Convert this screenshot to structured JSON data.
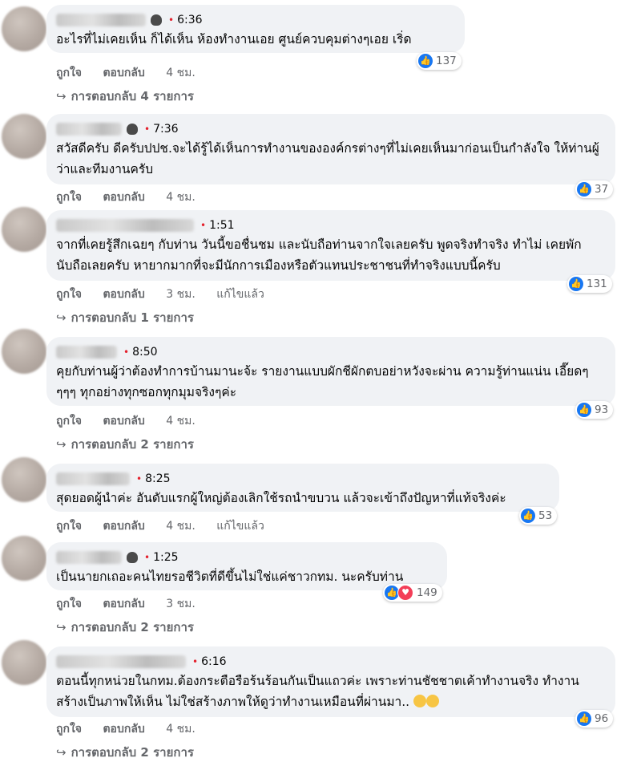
{
  "comments": [
    {
      "time": "6:36",
      "text": "อะไรที่ไม่เคยเห็น ก็ได้เห็น ห้องทำงานเอย ศูนย์ควบคุมต่างๆเอย เริ่ด",
      "like": "ถูกใจ",
      "reply": "ตอบกลับ",
      "age": "4 ชม.",
      "edited": "",
      "reactions": "137",
      "replies": "การตอบกลับ 4 รายการ"
    },
    {
      "time": "7:36",
      "text": "สวัสดีครับ ดีครับปปช.จะได้รู้ได้เห็นการทำงานขององค์กรต่างๆที่ไม่เคยเห็นมาก่อนเป็นกำลังใจ ให้ท่านผู้ว่าและทีมงานครับ",
      "like": "ถูกใจ",
      "reply": "ตอบกลับ",
      "age": "4 ชม.",
      "edited": "",
      "reactions": "37",
      "replies": ""
    },
    {
      "time": "1:51",
      "text": "จากที่เคยรู้สึกเฉยๆ กับท่าน วันนี้ขอชื่นชม และนับถือท่านจากใจเลยครับ พูดจริงทำจริง ทำไม่ เคยพัก นับถือเลยครับ หายากมากที่จะมีนักการเมืองหรือตัวแทนประชาชนที่ทำจริงแบบนี้ครับ",
      "like": "ถูกใจ",
      "reply": "ตอบกลับ",
      "age": "3 ชม.",
      "edited": "แก้ไขแล้ว",
      "reactions": "131",
      "replies": "การตอบกลับ 1 รายการ"
    },
    {
      "time": "8:50",
      "text": "คุยกับท่านผู้ว่าต้องทำการบ้านมานะจ้ะ รายงานแบบผักชีผักตบอย่าหวังจะผ่าน ความรู้ท่านแน่น เอี๊ยดๆๆๆๆ ทุกอย่างทุกซอกทุกมุมจริงๆค่ะ",
      "like": "ถูกใจ",
      "reply": "ตอบกลับ",
      "age": "4 ชม.",
      "edited": "",
      "reactions": "93",
      "replies": "การตอบกลับ 2 รายการ"
    },
    {
      "time": "8:25",
      "text": "สุดยอดผู้นำค่ะ อันดับแรกผู้ใหญ่ต้องเลิกใช้รถนำขบวน แล้วจะเข้าถึงปัญหาที่แท้จริงค่ะ",
      "like": "ถูกใจ",
      "reply": "ตอบกลับ",
      "age": "4 ชม.",
      "edited": "แก้ไขแล้ว",
      "reactions": "53",
      "replies": ""
    },
    {
      "time": "1:25",
      "text": "เป็นนายกเถอะคนไทยรอชีวิตที่ดีขึ้นไม่ใช่แค่ชาวกทม. นะครับท่าน",
      "like": "ถูกใจ",
      "reply": "ตอบกลับ",
      "age": "3 ชม.",
      "edited": "",
      "reactions": "149",
      "replies": "การตอบกลับ 2 รายการ"
    },
    {
      "time": "6:16",
      "text": "ตอนนี้ทุกหน่วยในกทม.ต้องกระตือรือร้นร้อนกันเป็นแถวค่ะ เพราะท่านชัชชาตเค้าทำงานจริง ทำงานสร้างเป็นภาพให้เห็น ไม่ใช่สร้างภาพให้ดูว่าทำงานเหมือนที่ผ่านมา..",
      "like": "ถูกใจ",
      "reply": "ตอบกลับ",
      "age": "4 ชม.",
      "edited": "",
      "reactions": "96",
      "replies": "การตอบกลับ 2 รายการ"
    }
  ],
  "icons": {
    "like": "like-thumb-icon",
    "love": "love-heart-icon",
    "reply_arrow": "reply-arrow-icon",
    "badge": "top-fan-badge-icon"
  }
}
